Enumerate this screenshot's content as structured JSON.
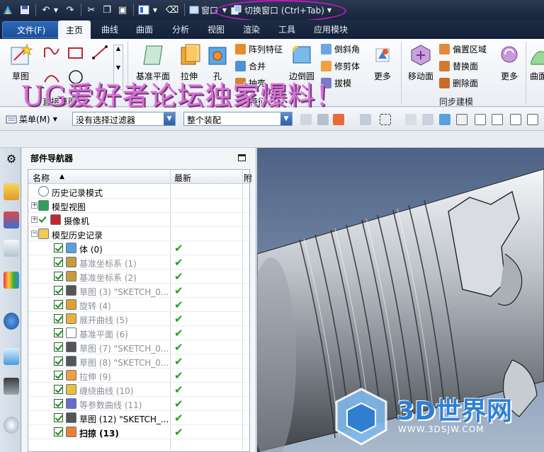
{
  "titlebar": {
    "window_label": "窗口",
    "switch_window_label": "切换窗口 (Ctrl+Tab)"
  },
  "menu": {
    "file": "文件(F)",
    "tabs": [
      "主页",
      "曲线",
      "曲面",
      "分析",
      "视图",
      "渲染",
      "工具",
      "应用模块"
    ],
    "active_tab": "主页"
  },
  "ribbon": {
    "sketch": "草图",
    "direct_sketch_group": "直接草图",
    "datum_plane": "基准平面",
    "extrude": "拉伸",
    "hole": "孔",
    "pattern_feature": "阵列特征",
    "unite": "合并",
    "shell": "抽壳",
    "feature_group": "特征",
    "edge_blend": "边倒圆",
    "chamfer": "倒斜角",
    "trim_body": "修剪体",
    "draft": "拔模",
    "more1": "更多",
    "move_face": "移动面",
    "offset_region": "偏置区域",
    "replace_face": "替换面",
    "delete_face": "删除面",
    "sync_modeling_group": "同步建模",
    "more2": "更多",
    "curve_short": "曲面",
    "watermark": "UG爱好者论坛独家爆料！"
  },
  "selection_bar": {
    "menu_label": "菜单(M)",
    "filter_value": "没有选择过滤器",
    "scope_value": "整个装配"
  },
  "navigator": {
    "title": "部件导航器",
    "col_name": "名称",
    "col_latest": "最新",
    "col_extra": "附",
    "rows": [
      {
        "label": "历史记录模式",
        "style": "normal"
      },
      {
        "label": "模型视图",
        "style": "normal"
      },
      {
        "label": "摄像机",
        "style": "normal"
      },
      {
        "label": "模型历史记录",
        "style": "normal"
      },
      {
        "label": "体 (0)",
        "style": "normal"
      },
      {
        "label": "基准坐标系 (1)",
        "style": "gray"
      },
      {
        "label": "基准坐标系 (2)",
        "style": "gray"
      },
      {
        "label": "草图 (3) \"SKETCH_0...",
        "style": "gray"
      },
      {
        "label": "旋转 (4)",
        "style": "gray"
      },
      {
        "label": "展开曲线 (5)",
        "style": "gray"
      },
      {
        "label": "基准平面 (6)",
        "style": "gray"
      },
      {
        "label": "草图 (7) \"SKETCH_0...",
        "style": "gray"
      },
      {
        "label": "草图 (8) \"SKETCH_0...",
        "style": "gray"
      },
      {
        "label": "拉伸 (9)",
        "style": "gray"
      },
      {
        "label": "缠绕曲线 (10)",
        "style": "gray"
      },
      {
        "label": "等参数曲线 (11)",
        "style": "gray"
      },
      {
        "label": "草图 (12) \"SKETCH_...",
        "style": "normal"
      },
      {
        "label": "扫掠 (13)",
        "style": "bold"
      }
    ]
  },
  "logo": {
    "name": "3D世界网",
    "url": "WWW.3DSJW.COM"
  },
  "colors": {
    "accent": "#1d4f98",
    "highlight_ellipse": "#c218c2",
    "check_green": "#1fa21f",
    "watermark": "#d56bd5"
  }
}
